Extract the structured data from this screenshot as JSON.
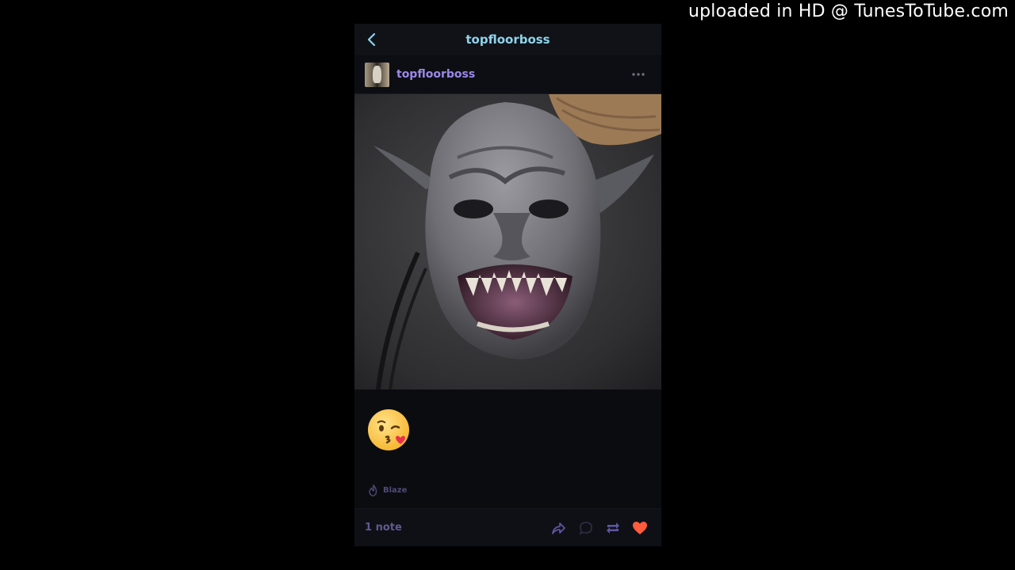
{
  "watermark": "uploaded in HD @ TunesToTube.com",
  "topbar": {
    "title": "topfloorboss",
    "back_icon": "chevron-left-icon"
  },
  "post": {
    "blog_name": "topfloorboss",
    "more_icon": "ellipsis-icon",
    "image_subject": "grey goblin mask with sharp teeth",
    "caption_emoji": "face-blowing-a-kiss",
    "blaze_label": "Blaze",
    "notes_label": "1 note",
    "actions": [
      "share-icon",
      "reply-icon",
      "reblog-icon",
      "heart-icon"
    ]
  },
  "colors": {
    "accent": "#9b88e8",
    "title": "#8fd4ea",
    "heart": "#ff5b3d",
    "background": "#000000"
  }
}
